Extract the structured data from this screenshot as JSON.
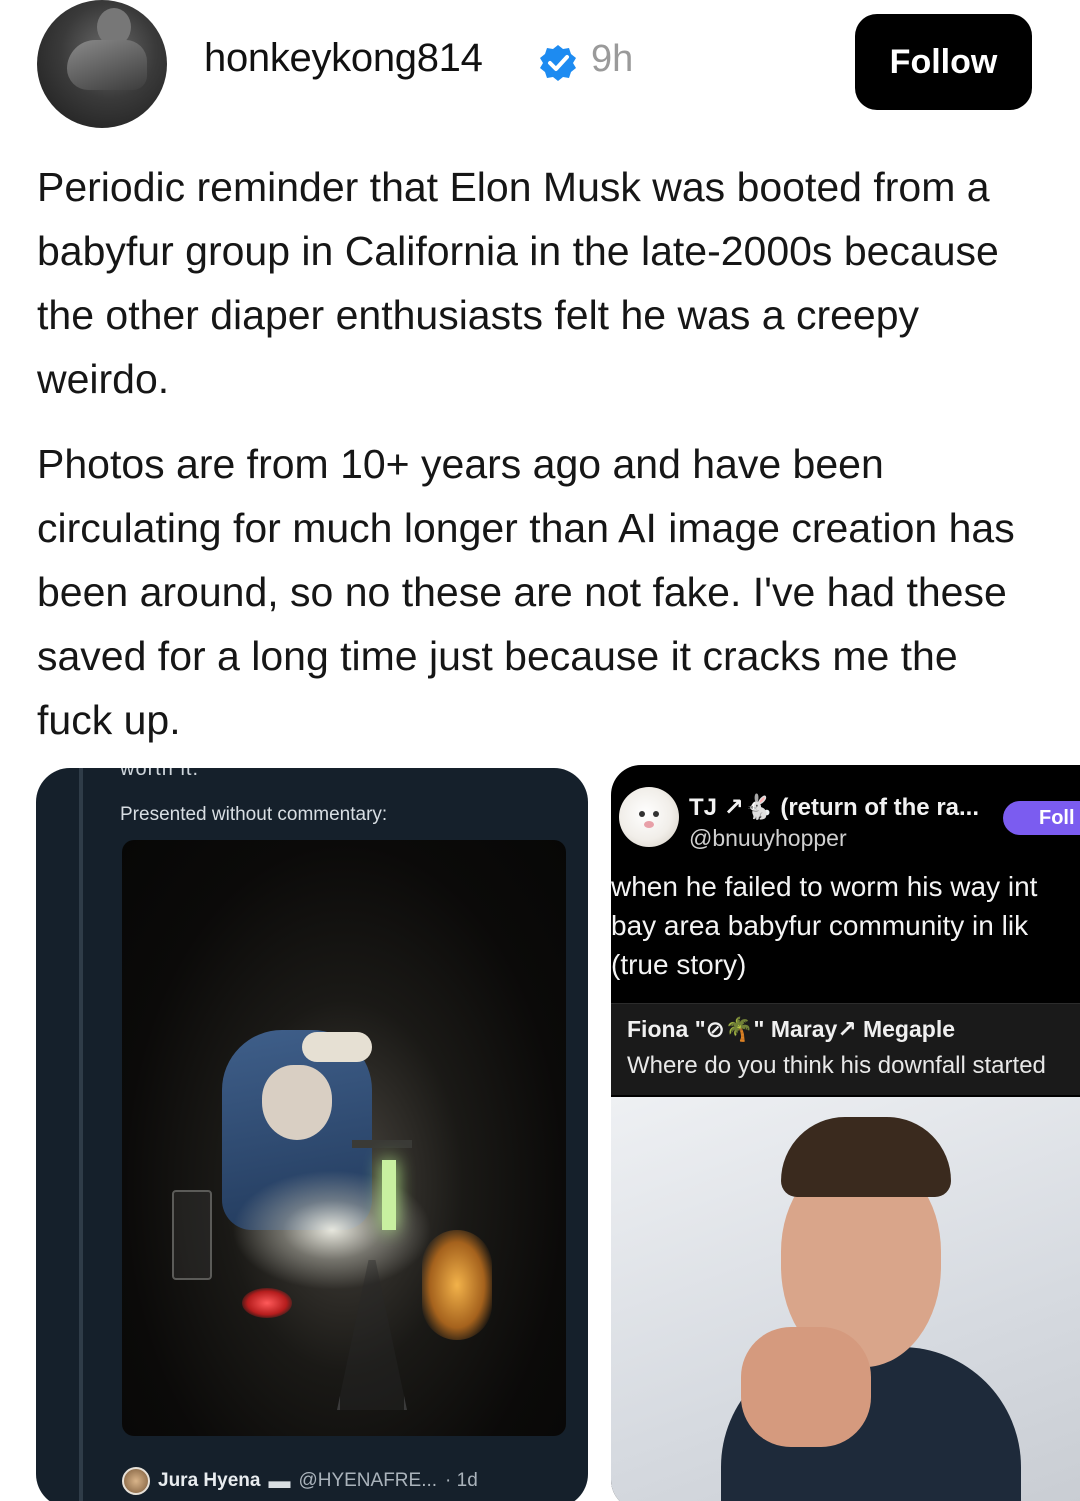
{
  "post": {
    "author": {
      "username": "honkeykong814",
      "verified": true,
      "time_ago": "9h"
    },
    "follow_label": "Follow",
    "paragraphs": [
      "Periodic reminder that Elon Musk was booted from a babyfur group in California in the late-2000s because the other diaper enthusiasts felt he was a creepy weirdo.",
      "Photos are from 10+ years ago and have been circulating for much longer than AI image creation has been around, so no these are not fake. I've had these saved for a long time just because it cracks me the fuck up."
    ]
  },
  "left_image": {
    "cut_text": "worth it.",
    "caption": "Presented without commentary:",
    "footer": {
      "name": "Jura Hyena",
      "handle": "@HYENAFRE...",
      "time": "· 1d"
    }
  },
  "right_image": {
    "tweet": {
      "name": "TJ ↗🐇 (return of the ra...",
      "handle": "@bnuuyhopper",
      "follow_label": "Foll",
      "body_lines": [
        "when he failed to worm his way int",
        "bay area babyfur community in lik",
        "(true story)"
      ]
    },
    "reply": {
      "names": "Fiona \"⊘🌴\" Maray↗ Megaple",
      "text": "Where do you think his downfall started"
    }
  },
  "colors": {
    "follow_bg": "#000000",
    "verified_blue": "#1d8bf1",
    "timestamp_gray": "#9a9a9a",
    "left_card_bg": "#15202b",
    "right_follow_purple": "#7b5cf0"
  }
}
